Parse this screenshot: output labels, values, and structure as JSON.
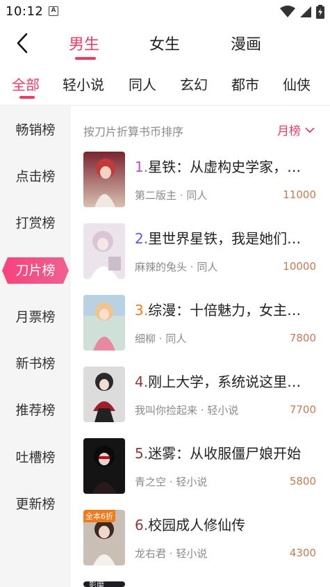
{
  "status": {
    "time": "10:12",
    "notification_letter": "A"
  },
  "header": {
    "tabs": [
      {
        "label": "男生",
        "active": true
      },
      {
        "label": "女生",
        "active": false
      },
      {
        "label": "漫画",
        "active": false
      }
    ]
  },
  "categories": [
    "全部",
    "轻小说",
    "同人",
    "玄幻",
    "都市",
    "仙侠"
  ],
  "sidebar": {
    "items": [
      "畅销榜",
      "点击榜",
      "打赏榜",
      "刀片榜",
      "月票榜",
      "新书榜",
      "推荐榜",
      "吐槽榜",
      "更新榜"
    ],
    "active_index": 3
  },
  "list_header": {
    "sort_text": "按刀片折算书币排序",
    "period": "月榜"
  },
  "books": [
    {
      "rank": "1.",
      "title": "星铁：从虚构史学家，…",
      "author": "第二版主",
      "category": "同人",
      "score": "11000",
      "rank_color": "#b24fd6"
    },
    {
      "rank": "2.",
      "title": "里世界星铁，我是她们…",
      "author": "麻辣的兔头",
      "category": "同人",
      "score": "10000",
      "rank_color": "#5b5bd6"
    },
    {
      "rank": "3.",
      "title": "综漫：十倍魅力，女主…",
      "author": "细柳",
      "category": "同人",
      "score": "7800",
      "rank_color": "#f07a1e"
    },
    {
      "rank": "4.",
      "title": "刚上大学，系统说这里…",
      "author": "我叫你捡起来",
      "category": "轻小说",
      "score": "7700",
      "rank_color": "#8b3a3a"
    },
    {
      "rank": "5.",
      "title": "迷雾：从收服僵尸娘开始",
      "author": "青之空",
      "category": "轻小说",
      "score": "5800",
      "rank_color": "#8b3a3a"
    },
    {
      "rank": "6.",
      "title": "校园成人修仙传",
      "author": "龙右君",
      "category": "轻小说",
      "score": "4300",
      "rank_color": "#8b3a3a",
      "badge": "全本6折"
    }
  ],
  "partial_cover_text": "影魔",
  "colors": {
    "accent": "#ee3a63",
    "score": "#c47a52",
    "sidebar_bg": "#f5f5f5"
  }
}
